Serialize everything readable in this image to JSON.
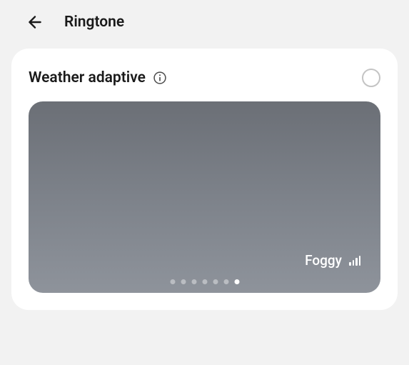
{
  "header": {
    "title": "Ringtone"
  },
  "card": {
    "title": "Weather adaptive",
    "selected": false
  },
  "preview": {
    "weather_label": "Foggy",
    "page_count": 7,
    "active_page": 7
  }
}
